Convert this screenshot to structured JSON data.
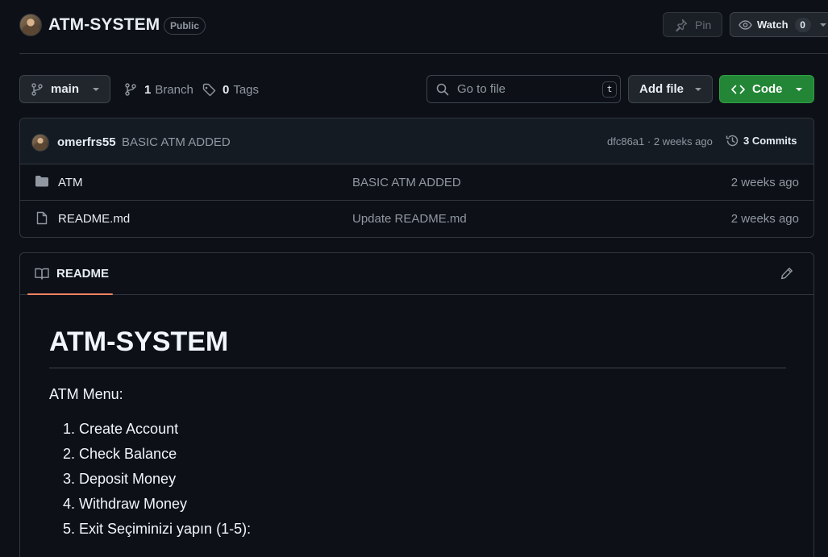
{
  "repo": {
    "name": "ATM-SYSTEM",
    "visibility": "Public",
    "pin_label": "Pin",
    "watch_label": "Watch",
    "watch_count": "0"
  },
  "toolbar": {
    "branch": "main",
    "branch_count": "1",
    "branch_label": "Branch",
    "tag_count": "0",
    "tag_label": "Tags",
    "search_placeholder": "Go to file",
    "search_shortcut": "t",
    "add_file_label": "Add file",
    "code_label": "Code"
  },
  "latest_commit": {
    "author": "omerfrs55",
    "message": "BASIC ATM ADDED",
    "hash_time": "dfc86a1 · 2 weeks ago",
    "commits_label": "3 Commits"
  },
  "files": [
    {
      "name": "ATM",
      "type": "folder",
      "commit_message": "BASIC ATM ADDED",
      "time": "2 weeks ago"
    },
    {
      "name": "README.md",
      "type": "file",
      "commit_message": "Update README.md",
      "time": "2 weeks ago"
    }
  ],
  "readme": {
    "tab_label": "README",
    "title": "ATM-SYSTEM",
    "intro": "ATM Menu:",
    "items": [
      "1. Create Account",
      "2. Check Balance",
      "3. Deposit Money",
      "4. Withdraw Money",
      "5. Exit Seçiminizi yapın (1-5):"
    ]
  },
  "colors": {
    "background": "#0d1117",
    "green_button": "#238636",
    "tab_accent": "#f78166"
  }
}
